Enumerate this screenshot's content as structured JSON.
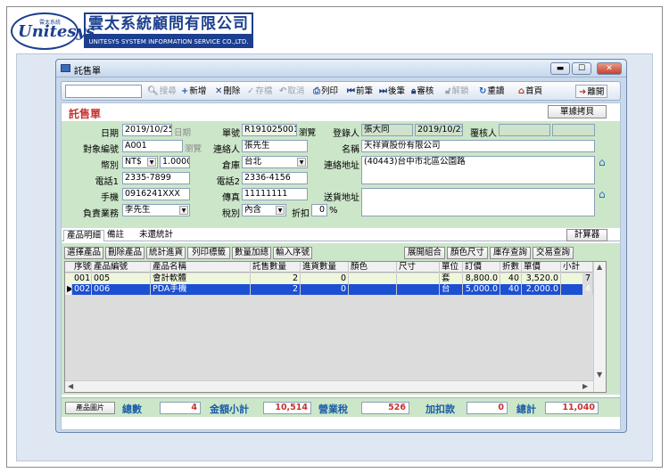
{
  "brand": {
    "logo_script": "Unitesys",
    "logo_small": "雲太系統",
    "company_cn": "雲太系統顧問有限公司",
    "company_en": "UNITESYS SYSTEM INFORMATION SERVICE CO.,LTD."
  },
  "window": {
    "title": "託售單",
    "min": "▬",
    "max": "☐",
    "close": "✕"
  },
  "toolbar": {
    "search_value": "",
    "search": "搜尋",
    "add": "新增",
    "delete": "刪除",
    "save": "存檔",
    "cancel": "取消",
    "print": "列印",
    "prev": "前筆",
    "next": "後筆",
    "audit": "審核",
    "unaudit": "解鎖",
    "reload": "重讀",
    "home": "首頁",
    "exit": "離開"
  },
  "form": {
    "title": "託售單",
    "copy_button": "單據拷貝",
    "date_label": "日期",
    "date_value": "2019/10/25",
    "date_link": "日期",
    "doc_no_label": "單號",
    "doc_no_value": "R191025001",
    "browse_label": "瀏覽",
    "registrar_label": "登錄人",
    "registrar_value": "張大同",
    "registrar_date": "2019/10/25",
    "reviewer_label": "覆核人",
    "reviewer_value": "",
    "reviewer_extra": "",
    "target_no_label": "對象編號",
    "target_no_value": "A001",
    "target_browse": "瀏覽",
    "contact_label": "連絡人",
    "contact_value": "張先生",
    "name_label": "名稱",
    "name_value": "天祥資股份有限公司",
    "currency_label": "幣別",
    "currency_value": "NT$",
    "rate_value": "1.0000",
    "warehouse_label": "倉庫",
    "warehouse_value": "台北",
    "address_label": "連絡地址",
    "address_value": "(40443)台中市北區公園路",
    "phone1_label": "電話1",
    "phone1_value": "2335-7899",
    "phone2_label": "電話2",
    "phone2_value": "2336-4156",
    "mobile_label": "手機",
    "mobile_value": "0916241XXX",
    "fax_label": "傳真",
    "fax_value": "11111111",
    "ship_address_label": "送貨地址",
    "ship_address_value": "",
    "sales_label": "負責業務",
    "sales_value": "李先生",
    "tax_label": "稅別",
    "tax_value": "內含",
    "discount_label": "折扣",
    "discount_value": "0",
    "discount_unit": "%"
  },
  "tabs": {
    "items": [
      "產品明細",
      "備註",
      "未還統計"
    ],
    "calc_button": "計算器"
  },
  "detail_buttons": {
    "left": [
      "選擇產品",
      "刪除產品",
      "統計進貨",
      "列印標籤",
      "數量加總",
      "輸入序號"
    ],
    "right": [
      "展開組合",
      "顏色尺寸",
      "庫存查詢",
      "交易查詢"
    ]
  },
  "grid": {
    "headers": [
      "序號",
      "產品編號",
      "產品名稱",
      "託售數量",
      "進貨數量",
      "顏色",
      "尺寸",
      "單位",
      "訂價",
      "折數",
      "單價",
      "小計"
    ],
    "rows": [
      [
        "001",
        "005",
        "會計軟體",
        "2",
        "0",
        "",
        "",
        "套",
        "8,800.0",
        "40",
        "3,520.0",
        "7"
      ],
      [
        "002",
        "006",
        "PDA手機",
        "2",
        "0",
        "",
        "",
        "台",
        "5,000.0",
        "40",
        "2,000.0",
        "4"
      ]
    ],
    "selected_row": 1,
    "row_marker": "▶"
  },
  "footer": {
    "image_button": "產品圖片",
    "total_qty_label": "總數",
    "total_qty": "4",
    "subtotal_label": "金額小計",
    "subtotal": "10,514",
    "tax_label": "營業稅",
    "tax": "526",
    "adjust_label": "加扣款",
    "adjust": "0",
    "total_label": "總計",
    "total": "11,040"
  }
}
